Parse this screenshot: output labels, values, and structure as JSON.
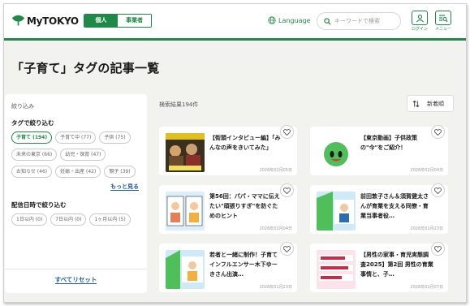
{
  "header": {
    "logo_text": "MyTOKYO",
    "segments": [
      {
        "label": "個人",
        "active": true
      },
      {
        "label": "事業者",
        "active": false
      }
    ],
    "language_label": "Language",
    "search_placeholder": "キーワードで検索",
    "login_label": "ログイン",
    "menu_label": "メニュー",
    "accent_color": "#1f8a47"
  },
  "page": {
    "title": "「子育て」タグの記事一覧"
  },
  "sidebar": {
    "heading": "絞り込み",
    "tag_filter_heading": "タグで絞り込む",
    "tags": [
      {
        "label": "子育て (194)",
        "selected": true
      },
      {
        "label": "子育て中 (77)",
        "selected": false
      },
      {
        "label": "子供 (75)",
        "selected": false
      },
      {
        "label": "未来の東京 (66)",
        "selected": false
      },
      {
        "label": "幼児・保育 (47)",
        "selected": false
      },
      {
        "label": "お知らせ (46)",
        "selected": false
      },
      {
        "label": "妊娠・出産 (42)",
        "selected": false
      },
      {
        "label": "親子 (39)",
        "selected": false
      }
    ],
    "more_label": "もっと見る",
    "date_filter_heading": "配信日時で絞り込む",
    "date_options": [
      {
        "label": "1日以内 (0)"
      },
      {
        "label": "7日以内 (0)"
      },
      {
        "label": "1ヶ月以内 (5)"
      }
    ],
    "reset_label": "すべてリセット"
  },
  "results": {
    "count_label": "検索結果194件",
    "sort_label": "新着順",
    "articles": [
      {
        "title": "【街頭インタビュー編】「みんなの声をきいてみた」",
        "date": "2026年02月05日",
        "thumb": "interview"
      },
      {
        "title": "【東京動画】子供政策の\"今\"をご紹介！",
        "date": "2026年02月04日",
        "thumb": "mascot"
      },
      {
        "title": "第56回：パパ・ママに伝えたい\"頑張りすぎ\"を防ぐためのヒント",
        "date": "2026年02月04日",
        "thumb": "manga"
      },
      {
        "title": "前田敦子さん＆須賀健太さんが育業を支える同僚・育業当事者役…",
        "date": "2026年01月23日",
        "thumb": "banner-green"
      },
      {
        "title": "若者と一緒に制作！子育てインフルエンサー木下ゆーきさん出演…",
        "date": "2026年01月23日",
        "thumb": "banner-green2"
      },
      {
        "title": "【男性の家事・育児実態調査2025】第2回 男性の育業事情と、子…",
        "date": "2026年01月07日",
        "thumb": "pink"
      }
    ]
  }
}
